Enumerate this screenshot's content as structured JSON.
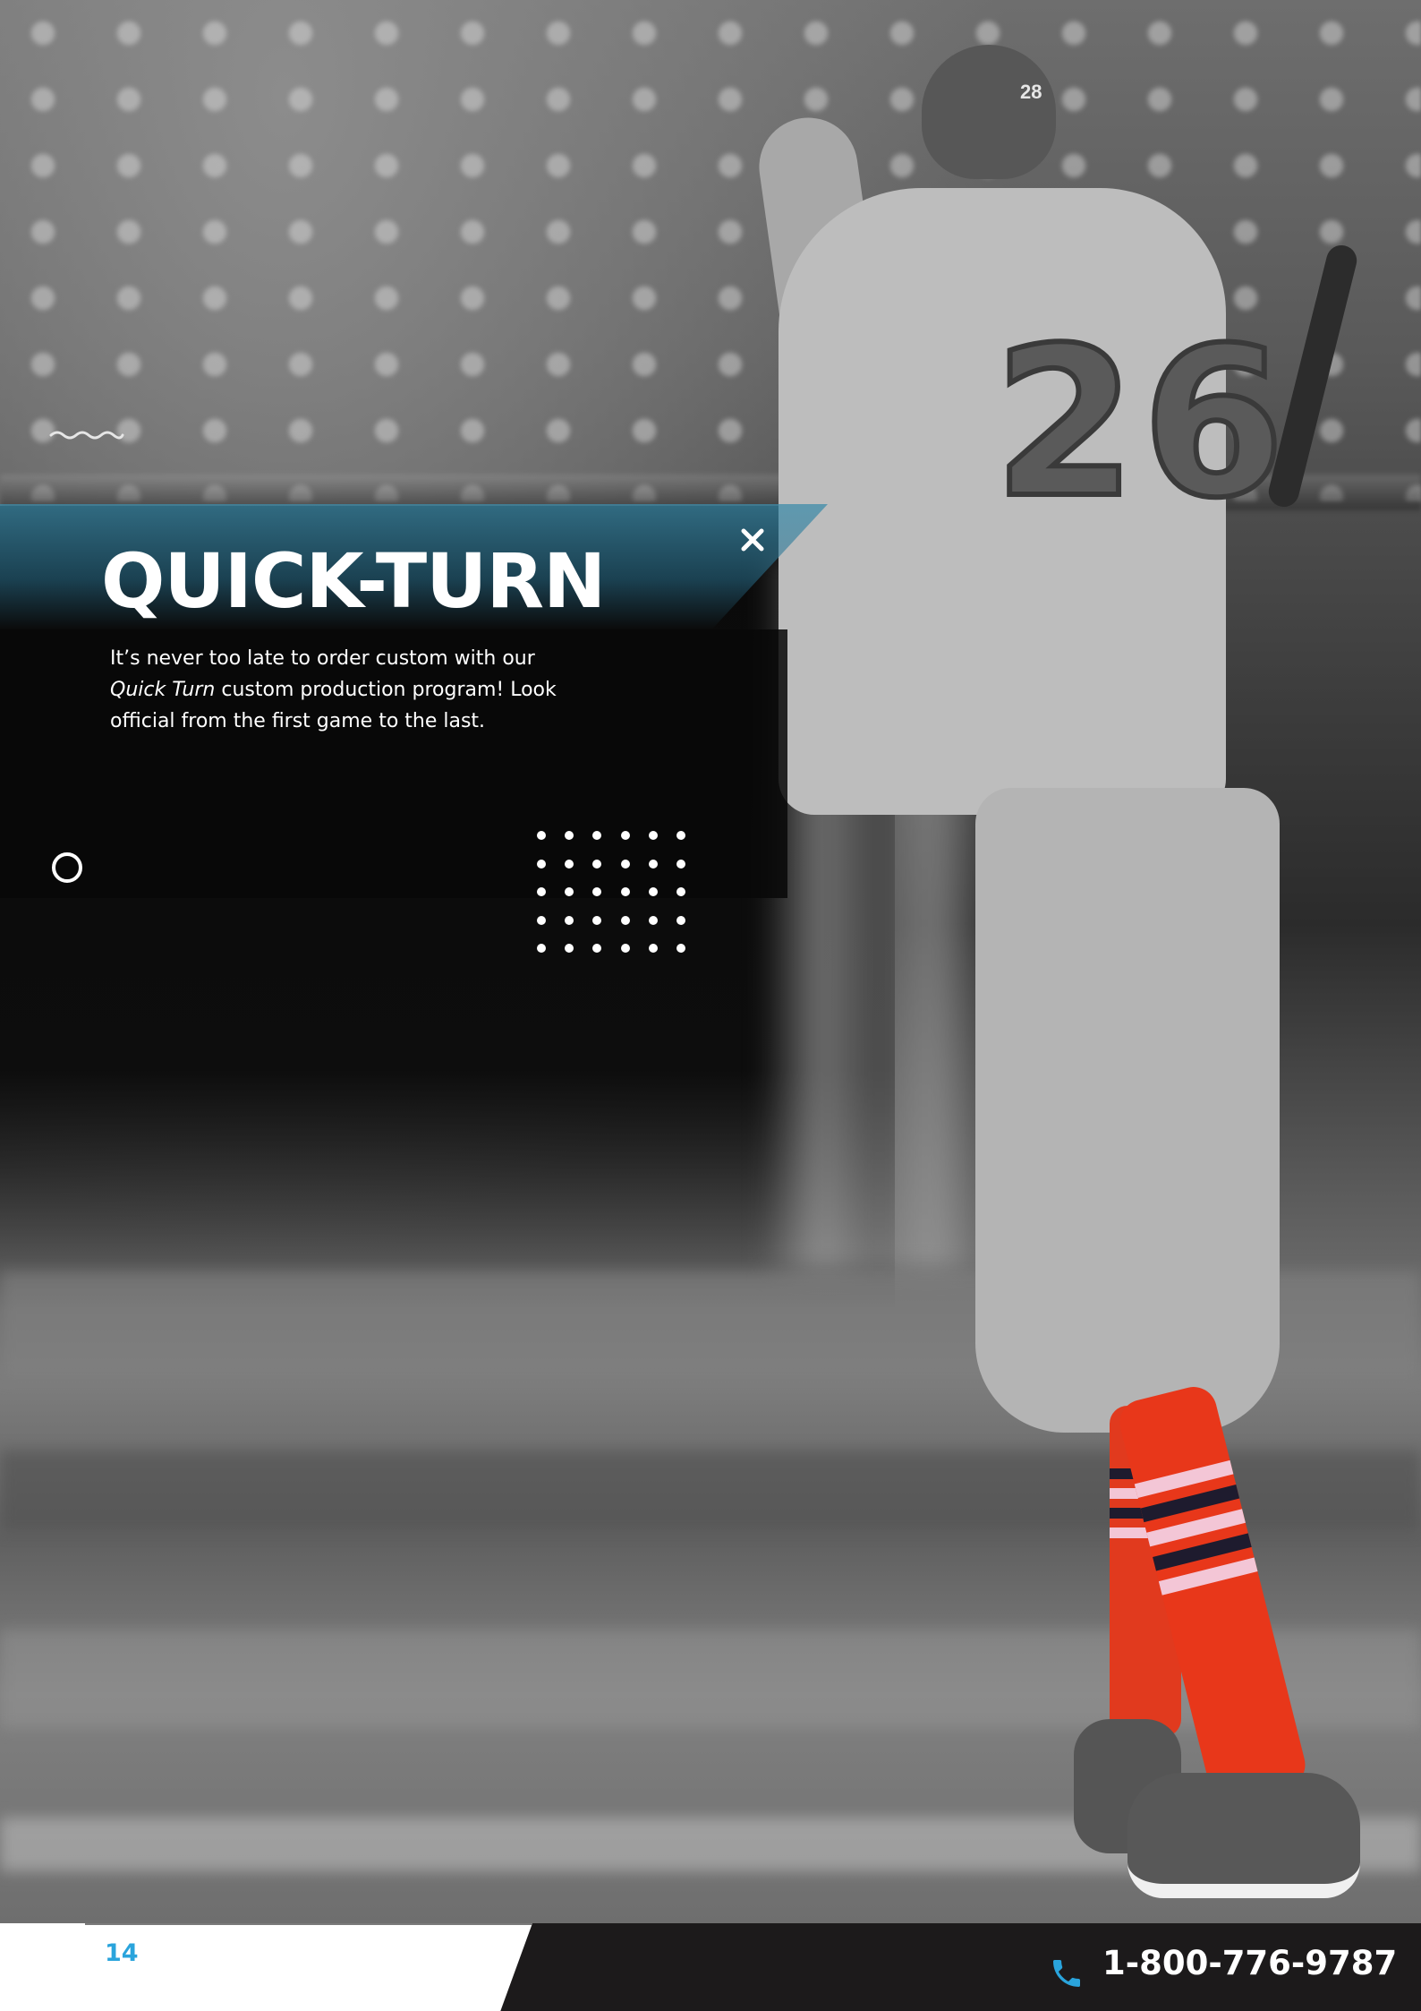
{
  "page": {
    "title": "QUICK-TURN",
    "body": {
      "line1": "It’s never too late to order custom with our",
      "line2_italic": "Quick Turn",
      "line2_rest": " custom production program! Look",
      "line3": "official from the first game to the last."
    }
  },
  "photo": {
    "jersey_number": "26",
    "helmet_number": "28"
  },
  "footer": {
    "page_number": "14",
    "phone": "1-800-776-9787",
    "phone_icon": "phone-icon"
  },
  "decorations": {
    "squiggle_icon": "wave-icon",
    "close_icon": "close-icon",
    "ring_icon": "circle-outline-icon",
    "dot_grid": {
      "columns": 6,
      "rows": 5
    }
  },
  "colors": {
    "accent_blue": "#2aa4dc",
    "band_teal": "#3e8caa",
    "footer_dark": "#1c1a1b",
    "sock_red": "#e8371a"
  }
}
